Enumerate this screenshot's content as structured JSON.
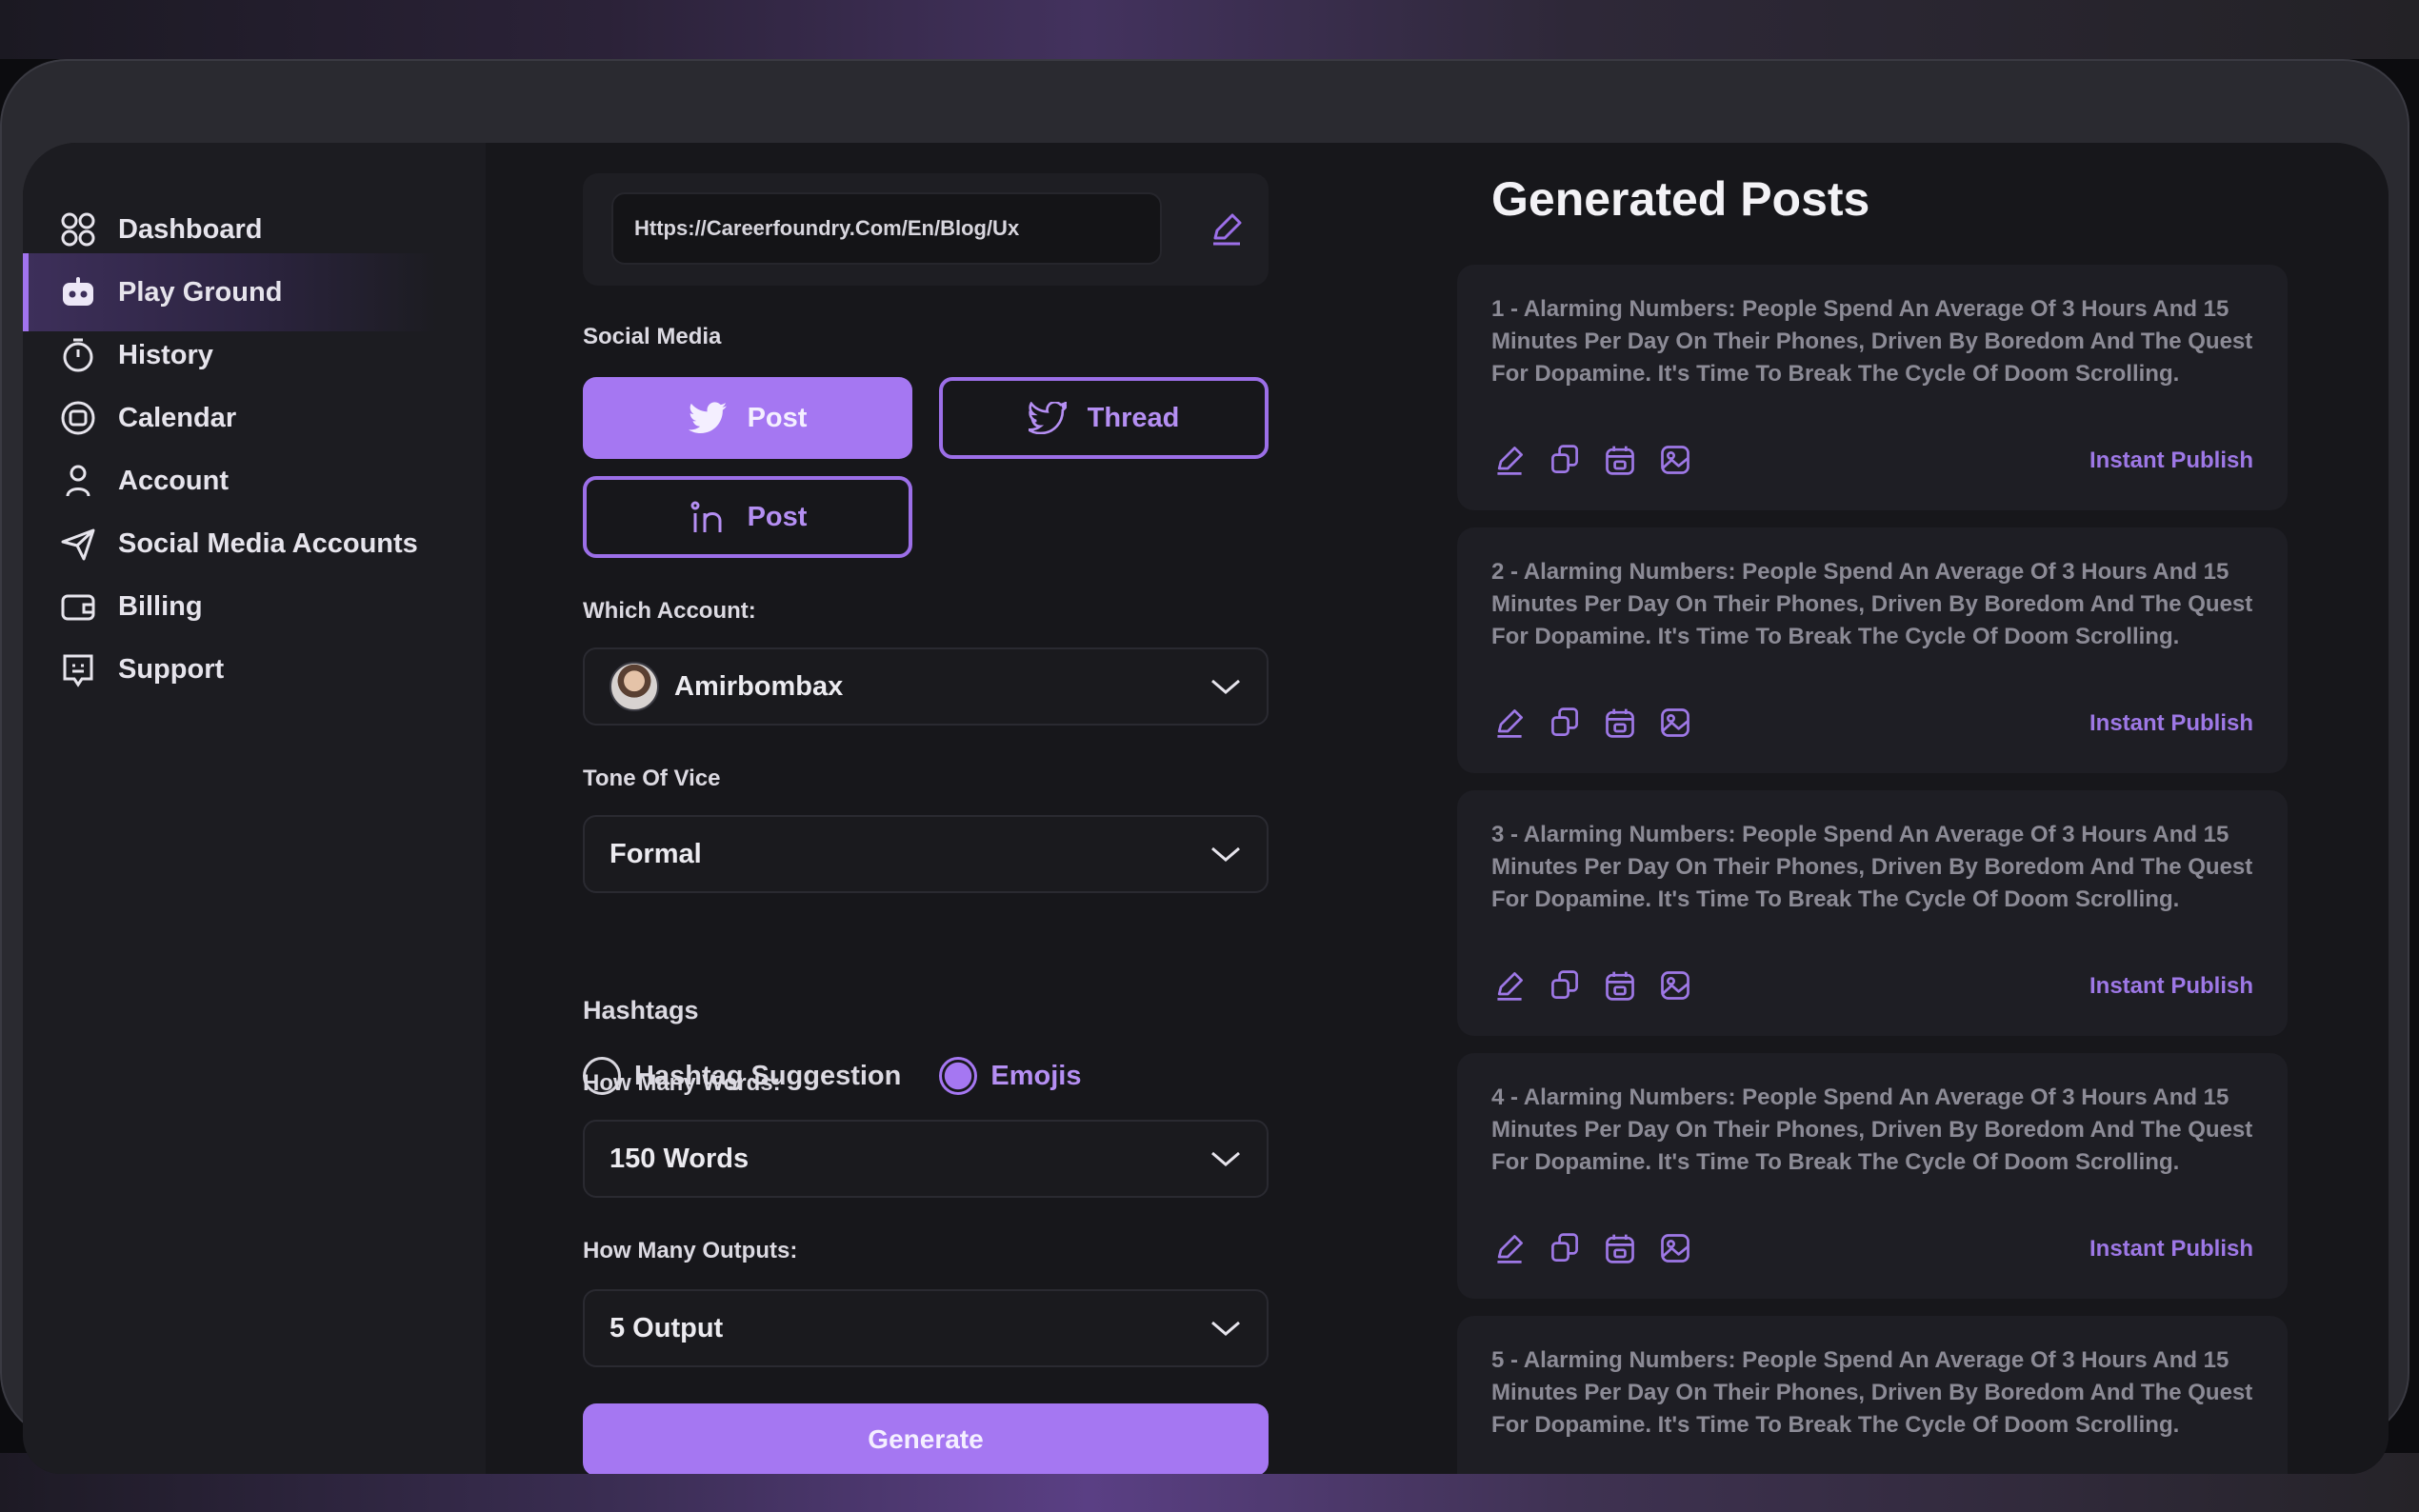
{
  "sidebar": {
    "items": [
      {
        "label": "Dashboard",
        "icon": "grid-icon",
        "active": false
      },
      {
        "label": "Play Ground",
        "icon": "robot-icon",
        "active": true
      },
      {
        "label": "History",
        "icon": "stopwatch-icon",
        "active": false
      },
      {
        "label": "Calendar",
        "icon": "calendar-circle-icon",
        "active": false
      },
      {
        "label": "Account",
        "icon": "user-icon",
        "active": false
      },
      {
        "label": "Social Media Accounts",
        "icon": "send-icon",
        "active": false
      },
      {
        "label": "Billing",
        "icon": "wallet-icon",
        "active": false
      },
      {
        "label": "Support",
        "icon": "support-icon",
        "active": false
      }
    ]
  },
  "form": {
    "url_value": "Https://Careerfoundry.Com/En/Blog/Ux",
    "social_media_label": "Social Media",
    "social_buttons": [
      {
        "label": "Post",
        "platform": "twitter",
        "selected": true
      },
      {
        "label": "Thread",
        "platform": "twitter",
        "selected": false
      },
      {
        "label": "Post",
        "platform": "linkedin",
        "selected": false
      }
    ],
    "account_label": "Which Account:",
    "account_value": "Amirbombax",
    "tone_label": "Tone Of Vice",
    "tone_value": "Formal",
    "hashtags_label": "Hashtags",
    "hashtag_option": "Hashtag Suggestion",
    "emoji_option": "Emojis",
    "words_label": "How Many Words:",
    "words_value": "150 Words",
    "outputs_label": "How Many Outputs:",
    "outputs_value": "5 Output",
    "generate_label": "Generate"
  },
  "posts": {
    "title": "Generated Posts",
    "publish_label": "Instant Publish",
    "items": [
      {
        "text": "1 - Alarming Numbers: People Spend An Average Of 3 Hours And 15 Minutes Per Day On Their Phones, Driven By Boredom And The Quest For Dopamine. It's Time To Break The Cycle Of Doom Scrolling."
      },
      {
        "text": "2 - Alarming Numbers: People Spend An Average Of 3 Hours And 15 Minutes Per Day On Their Phones, Driven By Boredom And The Quest For Dopamine. It's Time To Break The Cycle Of Doom Scrolling."
      },
      {
        "text": "3 - Alarming Numbers: People Spend An Average Of 3 Hours And 15 Minutes Per Day On Their Phones, Driven By Boredom And The Quest For Dopamine. It's Time To Break The Cycle Of Doom Scrolling."
      },
      {
        "text": "4 - Alarming Numbers: People Spend An Average Of 3 Hours And 15 Minutes Per Day On Their Phones, Driven By Boredom And The Quest For Dopamine. It's Time To Break The Cycle Of Doom Scrolling."
      },
      {
        "text": "5 - Alarming Numbers: People Spend An Average Of 3 Hours And 15 Minutes Per Day On Their Phones, Driven By Boredom And The Quest For Dopamine. It's Time To Break The Cycle Of Doom Scrolling."
      }
    ],
    "action_icons": [
      "edit-icon",
      "copy-icon",
      "schedule-icon",
      "image-icon"
    ]
  },
  "colors": {
    "accent": "#a577f2",
    "background": "#17171b",
    "sidebar": "#1c1c21",
    "card": "#1e1e24"
  }
}
